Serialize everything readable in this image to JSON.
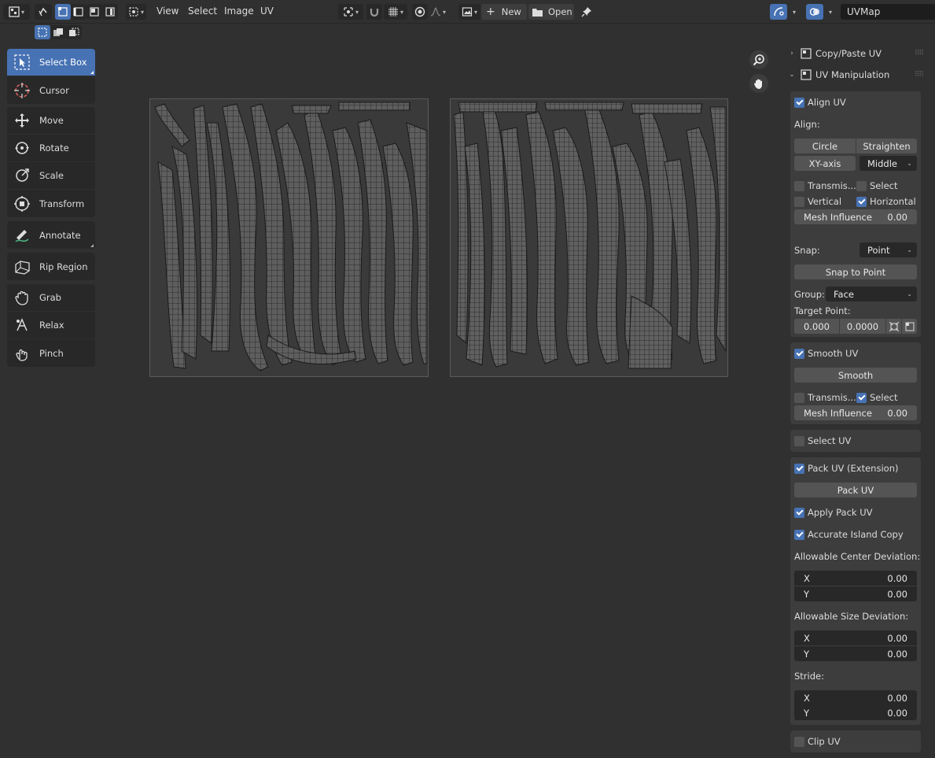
{
  "header": {
    "menus": [
      "View",
      "Select",
      "Image",
      "UV"
    ],
    "new_label": "New",
    "open_label": "Open",
    "uvmap_name": "UVMap"
  },
  "toolbar": {
    "tools": [
      {
        "label": "Select Box",
        "icon": "select-box-icon"
      },
      {
        "label": "Cursor",
        "icon": "cursor-icon"
      },
      {
        "label": "Move",
        "icon": "move-icon"
      },
      {
        "label": "Rotate",
        "icon": "rotate-icon"
      },
      {
        "label": "Scale",
        "icon": "scale-icon"
      },
      {
        "label": "Transform",
        "icon": "transform-icon"
      },
      {
        "label": "Annotate",
        "icon": "annotate-icon"
      },
      {
        "label": "Rip Region",
        "icon": "rip-region-icon"
      },
      {
        "label": "Grab",
        "icon": "grab-icon"
      },
      {
        "label": "Relax",
        "icon": "relax-icon"
      },
      {
        "label": "Pinch",
        "icon": "pinch-icon"
      }
    ],
    "active_tool": "Select Box"
  },
  "panel": {
    "copy_paste_title": "Copy/Paste UV",
    "uv_manip_title": "UV Manipulation",
    "align": {
      "enabled_label": "Align UV",
      "align_label": "Align:",
      "circle": "Circle",
      "straighten": "Straighten",
      "xy_axis": "XY-axis",
      "middle": "Middle",
      "transmission": "Transmis...",
      "select": "Select",
      "vertical": "Vertical",
      "horizontal": "Horizontal",
      "mesh_influence": "Mesh Influence",
      "mesh_influence_val": "0.00",
      "snap_label": "Snap:",
      "snap_val": "Point",
      "snap_to_point": "Snap to Point",
      "group_label": "Group:",
      "group_val": "Face",
      "target_label": "Target Point:",
      "target_x": "0.000",
      "target_y": "0.0000"
    },
    "smooth": {
      "enabled_label": "Smooth UV",
      "smooth_btn": "Smooth",
      "transmission": "Transmis...",
      "select": "Select",
      "mesh_influence": "Mesh Influence",
      "mesh_influence_val": "0.00"
    },
    "select_uv_label": "Select UV",
    "pack": {
      "enabled_label": "Pack UV (Extension)",
      "pack_btn": "Pack UV",
      "apply_pack": "Apply Pack UV",
      "accurate_copy": "Accurate Island Copy",
      "center_dev_label": "Allowable Center Deviation:",
      "size_dev_label": "Allowable Size Deviation:",
      "stride_label": "Stride:",
      "x_label": "X",
      "y_label": "Y",
      "center_x": "0.00",
      "center_y": "0.00",
      "size_x": "0.00",
      "size_y": "0.00",
      "stride_x": "0.00",
      "stride_y": "0.00"
    },
    "clip_uv_label": "Clip UV"
  }
}
